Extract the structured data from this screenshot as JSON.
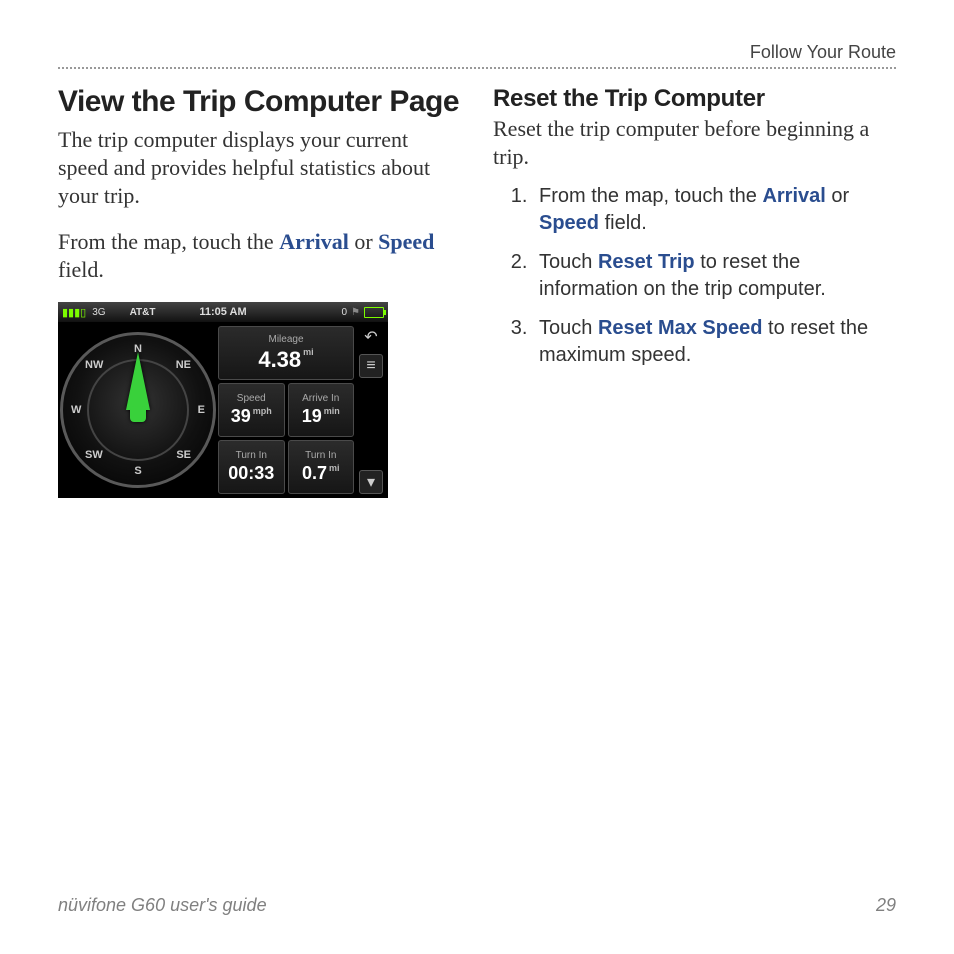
{
  "header": {
    "breadcrumb": "Follow Your Route"
  },
  "left": {
    "title": "View the Trip Computer Page",
    "intro": "The trip computer displays your current speed and provides helpful statistics about your trip.",
    "para2_pre": "From the map, touch the ",
    "para2_kw1": "Arrival",
    "para2_mid": " or ",
    "para2_kw2": "Speed",
    "para2_post": " field."
  },
  "device": {
    "status": {
      "signal": "3G",
      "carrier": "AT&T",
      "time": "11:05 AM",
      "bt": "0"
    },
    "compass_dirs": {
      "n": "N",
      "ne": "NE",
      "e": "E",
      "se": "SE",
      "s": "S",
      "sw": "SW",
      "w": "W",
      "nw": "NW"
    },
    "tiles": {
      "mileage": {
        "label": "Mileage",
        "value": "4.38",
        "unit": "mi"
      },
      "speed": {
        "label": "Speed",
        "value": "39",
        "unit": "mph"
      },
      "arrive": {
        "label": "Arrive In",
        "value": "19",
        "unit": "min"
      },
      "turn_t": {
        "label": "Turn In",
        "value": "00:33"
      },
      "turn_d": {
        "label": "Turn In",
        "value": "0.7",
        "unit": "mi"
      }
    }
  },
  "right": {
    "title": "Reset the Trip Computer",
    "intro": "Reset the trip computer before beginning a trip.",
    "steps": [
      {
        "pre": "From the map, touch the ",
        "kw1": "Arrival",
        "mid": " or ",
        "kw2": "Speed",
        "post": " field."
      },
      {
        "pre": "Touch ",
        "kw1": "Reset Trip",
        "post": " to reset the information on the trip computer."
      },
      {
        "pre": "Touch ",
        "kw1": "Reset Max Speed",
        "post": " to reset the maximum speed."
      }
    ]
  },
  "footer": {
    "guide": "nüvifone G60 user's guide",
    "page": "29"
  }
}
